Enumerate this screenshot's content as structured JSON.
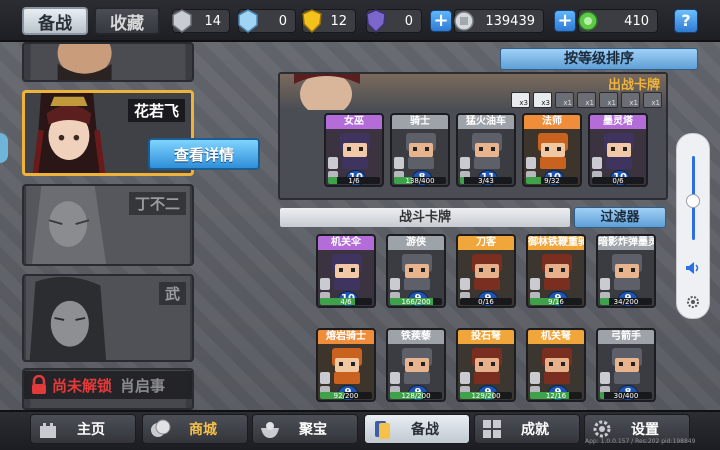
{
  "top_tabs": {
    "active": "备战",
    "inactive": "收藏"
  },
  "resources": [
    {
      "icon": "silver-key-icon",
      "value": "14"
    },
    {
      "icon": "blue-crystal-icon",
      "value": "0"
    },
    {
      "icon": "gold-shield-icon",
      "value": "12"
    },
    {
      "icon": "purple-shield-icon",
      "value": "0"
    },
    {
      "icon": "silver-coin-icon",
      "value": "139439"
    },
    {
      "icon": "green-gem-icon",
      "value": "410"
    }
  ],
  "help_label": "?",
  "heroes": [
    {
      "name": "花若飞",
      "detail_button": "查看详情"
    },
    {
      "name": "丁不二"
    },
    {
      "name": "武"
    },
    {
      "locked_label": "尚未解锁",
      "name": "肖启事"
    }
  ],
  "sort_button": "按等级排序",
  "deck": {
    "title": "出战卡牌",
    "multipliers": [
      "x3",
      "x3",
      "x1",
      "x1",
      "x1",
      "x1",
      "x1"
    ],
    "cards": [
      {
        "name": "女巫",
        "level": "10",
        "progress": "1/6",
        "progress_ratio": 0.17,
        "color": "purple"
      },
      {
        "name": "骑士",
        "level": "8",
        "progress": "138/400",
        "progress_ratio": 0.35,
        "color": "grey"
      },
      {
        "name": "猛火油车",
        "level": "11",
        "progress": "3/43",
        "progress_ratio": 0.07,
        "color": "grey"
      },
      {
        "name": "法师",
        "level": "10",
        "progress": "9/32",
        "progress_ratio": 0.28,
        "color": "orange"
      },
      {
        "name": "墨灵塔",
        "level": "10",
        "progress": "0/6",
        "progress_ratio": 0.0,
        "color": "purple"
      }
    ]
  },
  "battle_cards_label": "战斗卡牌",
  "filter_button": "过滤器",
  "battle_cards": [
    {
      "name": "机关伞",
      "level": "10",
      "progress": "4/6",
      "progress_ratio": 0.67,
      "color": "purple"
    },
    {
      "name": "游侠",
      "level": "9",
      "progress": "166/200",
      "progress_ratio": 0.83,
      "color": "grey"
    },
    {
      "name": "刀客",
      "level": "9",
      "progress": "0/16",
      "progress_ratio": 0.0,
      "color": "gold"
    },
    {
      "name": "御林铁鞭重骑兵",
      "level": "9",
      "progress": "9/16",
      "progress_ratio": 0.56,
      "color": "gold"
    },
    {
      "name": "暗影炸弹墨灵",
      "level": "9",
      "progress": "34/200",
      "progress_ratio": 0.17,
      "color": "grey"
    },
    {
      "name": "熔岩骑士",
      "level": "9",
      "progress": "92/200",
      "progress_ratio": 0.46,
      "color": "orange"
    },
    {
      "name": "铁蒺藜",
      "level": "9",
      "progress": "128/200",
      "progress_ratio": 0.64,
      "color": "grey"
    },
    {
      "name": "投石弩",
      "level": "9",
      "progress": "129/200",
      "progress_ratio": 0.65,
      "color": "gold"
    },
    {
      "name": "机关弩",
      "level": "9",
      "progress": "12/16",
      "progress_ratio": 0.75,
      "color": "gold"
    },
    {
      "name": "弓箭手",
      "level": "8",
      "progress": "30/400",
      "progress_ratio": 0.08,
      "color": "grey"
    }
  ],
  "bottom_nav": [
    {
      "label": "主页",
      "icon": "castle-icon"
    },
    {
      "label": "商城",
      "icon": "coins-icon"
    },
    {
      "label": "聚宝",
      "icon": "treasure-bowl-icon"
    },
    {
      "label": "备战",
      "icon": "card-deck-icon"
    },
    {
      "label": "成就",
      "icon": "achievement-grid-icon"
    },
    {
      "label": "设置",
      "icon": "gear-icon"
    }
  ],
  "version_text": "App: 1.0.0.157 / Res:202 pid:198849"
}
